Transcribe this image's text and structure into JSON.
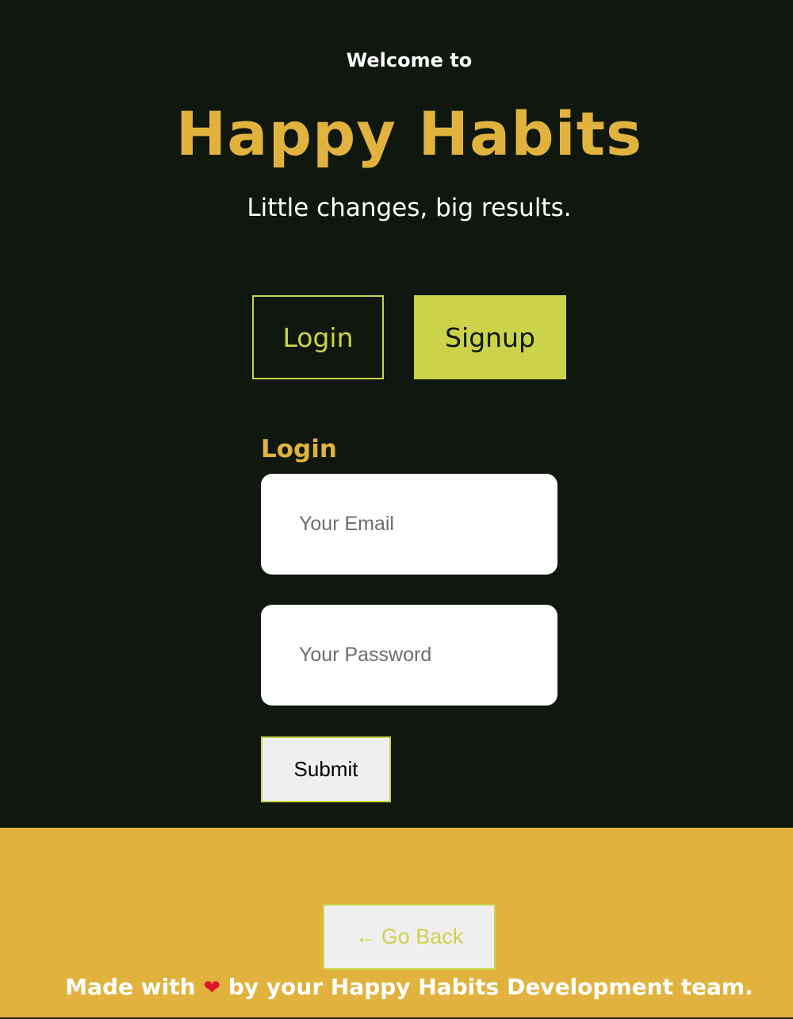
{
  "hero": {
    "welcome": "Welcome to",
    "title": "Happy Habits",
    "tagline": "Little changes, big results."
  },
  "tabs": {
    "login_label": "Login",
    "signup_label": "Signup"
  },
  "form": {
    "heading": "Login",
    "email": {
      "placeholder": "Your Email",
      "value": ""
    },
    "password": {
      "placeholder": "Your Password",
      "value": ""
    },
    "submit_label": "Submit"
  },
  "footer": {
    "back_arrow": "←",
    "back_label": "Go Back",
    "credit_prefix": "Made with",
    "credit_icon": "heart-icon",
    "credit_heart": "❤",
    "credit_suffix": "by your Happy Habits Development team."
  },
  "colors": {
    "background": "#0f170f",
    "accent_gold": "#e1b33e",
    "accent_lime": "#cbd34b",
    "heart": "#e0182d"
  }
}
